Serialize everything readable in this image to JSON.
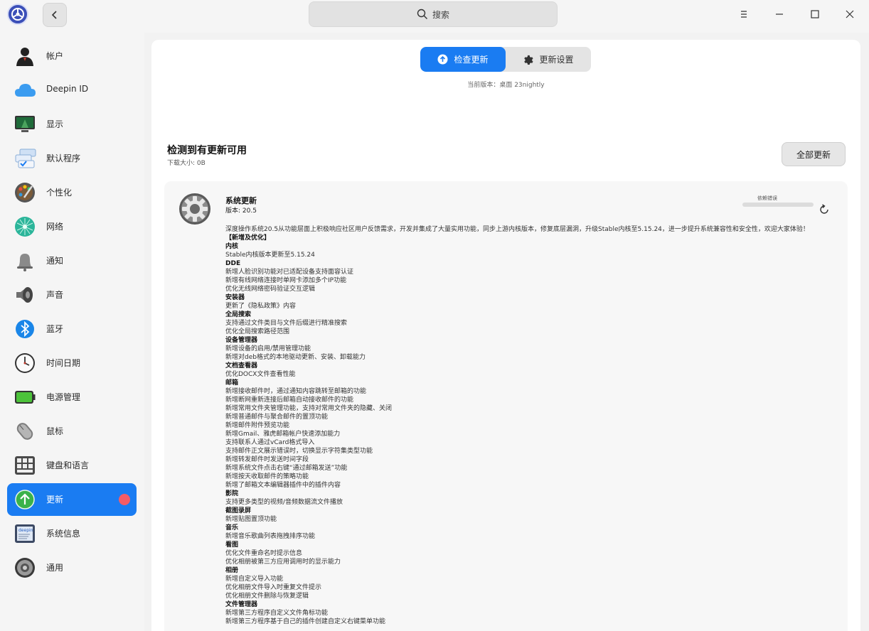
{
  "titlebar": {
    "search_placeholder": "搜索"
  },
  "sidebar": {
    "items": [
      {
        "label": "帐户",
        "icon": "account-icon"
      },
      {
        "label": "Deepin ID",
        "icon": "cloud-icon"
      },
      {
        "label": "显示",
        "icon": "display-icon"
      },
      {
        "label": "默认程序",
        "icon": "default-apps-icon"
      },
      {
        "label": "个性化",
        "icon": "palette-icon"
      },
      {
        "label": "网络",
        "icon": "network-icon"
      },
      {
        "label": "通知",
        "icon": "bell-icon"
      },
      {
        "label": "声音",
        "icon": "speaker-icon"
      },
      {
        "label": "蓝牙",
        "icon": "bluetooth-icon"
      },
      {
        "label": "时间日期",
        "icon": "clock-icon"
      },
      {
        "label": "电源管理",
        "icon": "battery-icon"
      },
      {
        "label": "鼠标",
        "icon": "mouse-icon"
      },
      {
        "label": "键盘和语言",
        "icon": "keyboard-icon"
      },
      {
        "label": "更新",
        "icon": "update-arrow-icon",
        "active": true
      },
      {
        "label": "系统信息",
        "icon": "system-info-icon"
      },
      {
        "label": "通用",
        "icon": "general-gear-icon"
      }
    ]
  },
  "tabs": {
    "check_label": "检查更新",
    "settings_label": "更新设置"
  },
  "current_version": "当前版本：桌面 23nightly",
  "header": {
    "title": "检测到有更新可用",
    "download_size": "下载大小: 0B",
    "update_all_label": "全部更新"
  },
  "package": {
    "name": "系统更新",
    "version": "版本: 20.5",
    "status_label": "依赖错误",
    "progress": 0,
    "notes": [
      {
        "t": "深度操作系统20.5从功能层面上积极响应社区用户反馈需求，开发并集成了大量实用功能，同步上游内核版本，修复底层漏洞，升级Stable内核至5.15.24，进一步提升系统兼容性和安全性，欢迎大家体验！",
        "b": false
      },
      {
        "t": "【新增及优化】",
        "b": true
      },
      {
        "t": "内核",
        "b": true
      },
      {
        "t": "Stable内核版本更新至5.15.24",
        "b": false
      },
      {
        "t": "DDE",
        "b": true
      },
      {
        "t": "新增人脸识别功能对已适配设备支持面容认证",
        "b": false
      },
      {
        "t": "新增有线网络连接时单网卡添加多个IP功能",
        "b": false
      },
      {
        "t": "优化无线网络密码验证交互逻辑",
        "b": false
      },
      {
        "t": "安装器",
        "b": true
      },
      {
        "t": "更新了《隐私政策》内容",
        "b": false
      },
      {
        "t": "全局搜索",
        "b": true
      },
      {
        "t": "支持通过文件类目与文件后缀进行精准搜索",
        "b": false
      },
      {
        "t": "优化全局搜索路径范围",
        "b": false
      },
      {
        "t": "设备管理器",
        "b": true
      },
      {
        "t": "新增设备的启用/禁用管理功能",
        "b": false
      },
      {
        "t": "新增对deb格式的本地驱动更新、安装、卸载能力",
        "b": false
      },
      {
        "t": "文档查看器",
        "b": true
      },
      {
        "t": "优化DOCX文件查看性能",
        "b": false
      },
      {
        "t": "邮箱",
        "b": true
      },
      {
        "t": "新增接收邮件时，通过通知内容跳转至邮箱的功能",
        "b": false
      },
      {
        "t": "新增断网重新连接后邮箱自动接收邮件的功能",
        "b": false
      },
      {
        "t": "新增常用文件夹管理功能，支持对常用文件夹的隐藏、关闭",
        "b": false
      },
      {
        "t": "新增普通邮件与聚合邮件的置顶功能",
        "b": false
      },
      {
        "t": "新增邮件附件预览功能",
        "b": false
      },
      {
        "t": "新增Gmail、雅虎邮箱帐户快速添加能力",
        "b": false
      },
      {
        "t": "支持联系人通过vCard格式导入",
        "b": false
      },
      {
        "t": "支持邮件正文展示错误时，切换显示字符集类型功能",
        "b": false
      },
      {
        "t": "新增转发邮件时发送时间字段",
        "b": false
      },
      {
        "t": "新增系统文件点击右键“通过邮箱发送”功能",
        "b": false
      },
      {
        "t": "新增按天收取邮件的策略功能",
        "b": false
      },
      {
        "t": "新增了邮箱文本编辑器插件中的插件内容",
        "b": false
      },
      {
        "t": "影院",
        "b": true
      },
      {
        "t": "支持更多类型的视频/音频数据流文件播放",
        "b": false
      },
      {
        "t": "截图录屏",
        "b": true
      },
      {
        "t": "新增贴图置顶功能",
        "b": false
      },
      {
        "t": "音乐",
        "b": true
      },
      {
        "t": "新增音乐歌曲列表拖拽排序功能",
        "b": false
      },
      {
        "t": "看图",
        "b": true
      },
      {
        "t": "优化文件重命名时提示信息",
        "b": false
      },
      {
        "t": "优化相册被第三方应用调用时的显示能力",
        "b": false
      },
      {
        "t": "相册",
        "b": true
      },
      {
        "t": "新增自定义导入功能",
        "b": false
      },
      {
        "t": "优化相册文件导入时重复文件提示",
        "b": false
      },
      {
        "t": "优化相册文件删除与恢复逻辑",
        "b": false
      },
      {
        "t": "文件管理器",
        "b": true
      },
      {
        "t": "新增第三方程序自定义文件角标功能",
        "b": false
      },
      {
        "t": "新增第三方程序基于自己的插件创建自定义右键菜单功能",
        "b": false
      }
    ]
  },
  "colors": {
    "accent": "#1a7cf2",
    "badge": "#f45c67"
  }
}
